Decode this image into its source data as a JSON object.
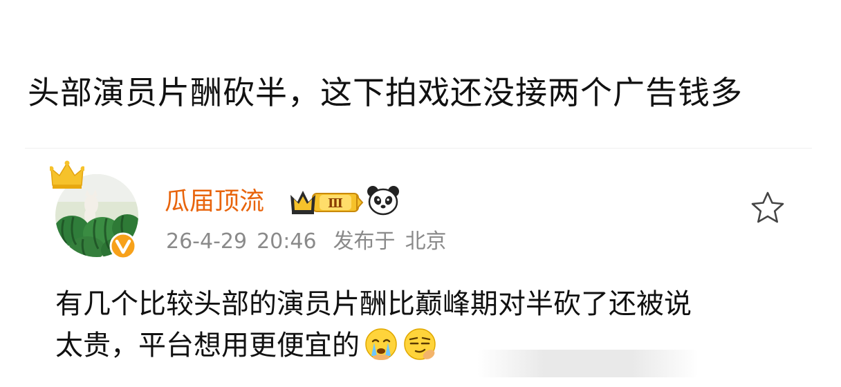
{
  "headline": "头部演员片酬砍半，这下拍戏还没接两个广告钱多",
  "post": {
    "author": {
      "name": "瓜届顶流",
      "vip_level": "Ⅲ",
      "avatar_icon": "watermelon-cat-avatar",
      "verified_icon": "verified-v-badge",
      "badge_icon": "panda-icon"
    },
    "date": "26-4-29",
    "time": "20:46",
    "published_label": "发布于",
    "location": "北京",
    "body_line1": "有几个比较头部的演员片酬比巅峰期对半砍了还被说",
    "body_line2": "太贵，平台想用更便宜的",
    "emojis": [
      "crying-emoji",
      "smug-emoji"
    ],
    "favorite_icon": "star-icon"
  },
  "colors": {
    "username": "#e8640c",
    "meta": "#8a8a8a",
    "text": "#111111",
    "badge_gold": "#f4b400"
  }
}
